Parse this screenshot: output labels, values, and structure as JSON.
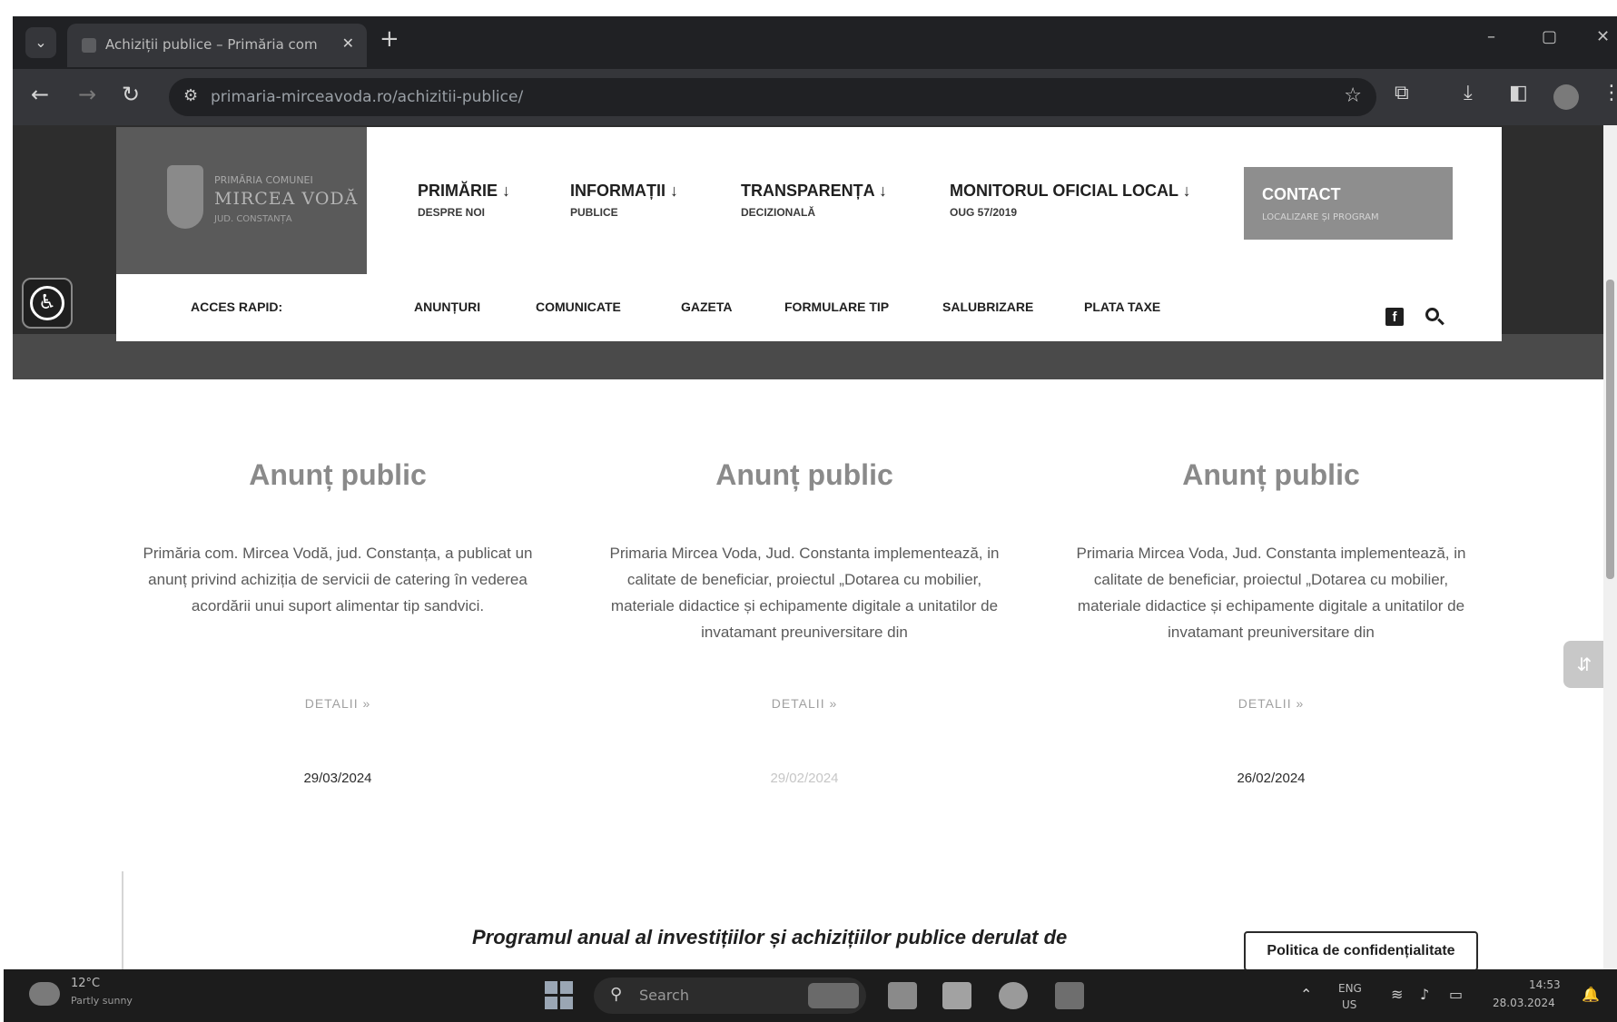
{
  "browser": {
    "tab_title": "Achiziții publice – Primăria com",
    "tab_close": "✕",
    "new_tab": "+",
    "url": "primaria-mirceavoda.ro/achizitii-publice/",
    "window_controls": {
      "minimize": "–",
      "maximize": "▢",
      "close": "✕"
    },
    "icons": [
      "back-arrow-icon",
      "forward-arrow-icon",
      "reload-icon",
      "site-info-icon",
      "star-icon",
      "extensions-icon",
      "download-icon",
      "side-panel-icon",
      "profile-avatar",
      "kebab-menu-icon"
    ]
  },
  "site": {
    "logo": {
      "line1": "PRIMĂRIA COMUNEI",
      "line2": "MIRCEA VODĂ",
      "line3": "JUD. CONSTANȚA"
    },
    "menu": [
      {
        "title": "PRIMĂRIE ↓",
        "sub": "DESPRE NOI"
      },
      {
        "title": "INFORMAȚII ↓",
        "sub": "PUBLICE"
      },
      {
        "title": "TRANSPARENȚA ↓",
        "sub": "DECIZIONALĂ"
      },
      {
        "title": "MONITORUL OFICIAL LOCAL ↓",
        "sub": "OUG 57/2019"
      }
    ],
    "contact": {
      "label": "CONTACT",
      "sub": "LOCALIZARE ȘI PROGRAM"
    },
    "quick_access": "ACCES RAPID:",
    "quick_links": [
      "ANUNȚURI",
      "COMUNICATE",
      "GAZETA",
      "FORMULARE TIP",
      "SALUBRIZARE",
      "PLATA TAXE"
    ],
    "facebook_glyph": "f",
    "accessibility_glyph": "♿"
  },
  "cards": [
    {
      "title": "Anunț public",
      "text": "Primăria com. Mircea Vodă, jud. Constanța, a publicat un anunț privind achiziția de servicii de catering în vederea acordării unui suport alimentar    tip sandvici.",
      "details": "DETALII »",
      "date": "29/03/2024"
    },
    {
      "title": "Anunț public",
      "text": "Primaria Mircea Voda, Jud. Constanta implementează, in calitate de beneficiar, proiectul „Dotarea cu mobilier, materiale didactice și echipamente digitale a unitatilor de invatamant preuniversitare din",
      "details": "DETALII »",
      "date": "29/02/2024"
    },
    {
      "title": "Anunț public",
      "text": "Primaria Mircea Voda, Jud. Constanta implementează, in calitate de beneficiar, proiectul „Dotarea cu mobilier, materiale didactice și echipamente digitale a unitatilor de invatamant preuniversitare din",
      "details": "DETALII »",
      "date": "26/02/2024"
    }
  ],
  "program_heading": "Programul anual al investițiilor și achizițiilor publice derulat de",
  "privacy_button": "Politica de confidențialitate",
  "taskbar": {
    "weather_temp": "12°C",
    "weather_desc": "Partly sunny",
    "search_placeholder": "Search",
    "lang_line1": "ENG",
    "lang_line2": "US",
    "time": "14:53",
    "date": "28.03.2024"
  },
  "colors": {
    "chrome_dark": "#202124",
    "chrome_toolbar": "#35363a",
    "contact_button": "#8e8e8e",
    "card_title": "#8a8a8a"
  }
}
